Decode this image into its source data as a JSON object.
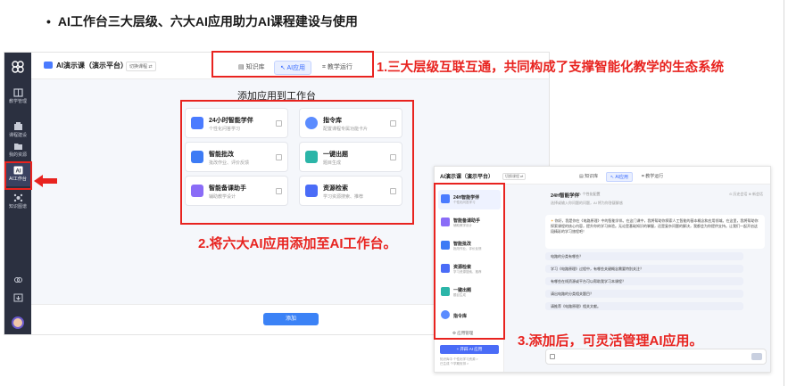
{
  "slide": {
    "bullet": "•",
    "title": "AI工作台三大层级、六大AI应用助力AI课程建设与使用"
  },
  "main_app": {
    "app_name": "AI演示课（演示平台）",
    "switch_course": "切换课程 ⇄",
    "tabs": [
      {
        "label": "知识库",
        "active": false
      },
      {
        "label": "AI应用",
        "active": true
      },
      {
        "label": "教学运行",
        "active": false
      }
    ],
    "sidebar": [
      {
        "label": "教学管理",
        "icon": "book-icon"
      },
      {
        "label": "课程建设",
        "icon": "build-icon"
      },
      {
        "label": "我的资源",
        "icon": "folder-icon"
      },
      {
        "label": "AI工作台",
        "icon": "ai-icon",
        "active": true
      },
      {
        "label": "知识图谱",
        "icon": "graph-icon"
      }
    ],
    "content_title": "添加应用到工作台",
    "apps": [
      {
        "title": "24小时智能学伴",
        "subtitle": "个性化问答学习",
        "color": "#4a7bff"
      },
      {
        "title": "指令库",
        "subtitle": "配置课程专属功能卡片",
        "color": "#5b8cff"
      },
      {
        "title": "智能批改",
        "subtitle": "批改作业、评价反馈",
        "color": "#3d7bf5"
      },
      {
        "title": "一键出题",
        "subtitle": "题目生成",
        "color": "#2bb5a8"
      },
      {
        "title": "智能备课助手",
        "subtitle": "辅助教学设计",
        "color": "#8a6cf7"
      },
      {
        "title": "资源检索",
        "subtitle": "学习资源搜索、推荐",
        "color": "#4a6cf7"
      }
    ],
    "add_button": "添加"
  },
  "annotations": {
    "a1": "1.三大层级互联互通，共同构成了支撑智能化教学的生态系统",
    "a2": "2.将六大AI应用添加至AI工作台。",
    "a3": "3.添加后，可灵活管理AI应用。"
  },
  "second_app": {
    "app_name": "AI演示课（演示平台）",
    "switch_course": "切换课程 ⇄",
    "tabs": [
      "知识库",
      "AI应用",
      "教学运行"
    ],
    "side_items": [
      {
        "title": "24H智能学伴",
        "subtitle": "个性化问答学习",
        "color": "#4a7bff",
        "active": true
      },
      {
        "title": "智能备课助手",
        "subtitle": "辅助教学设计",
        "color": "#8a6cf7"
      },
      {
        "title": "智能批改",
        "subtitle": "批改作业、评价反馈",
        "color": "#3d7bf5"
      },
      {
        "title": "资源检索",
        "subtitle": "学习资源搜索、推荐",
        "color": "#4a6cf7"
      },
      {
        "title": "一键出题",
        "subtitle": "题目生成",
        "color": "#2bb5a8"
      },
      {
        "title": "指令库",
        "subtitle": "",
        "color": "#5b8cff"
      }
    ],
    "manage_label": "⚙ 应用管理",
    "open_button": "+ 开辟 AI 应用",
    "foot1": "知识库中  个性化学习资源 >",
    "foot2": "已生成  个学期安排 >",
    "main_header": "24H智能学伴",
    "main_header_sub": "✎ 个性化配置",
    "main_header_right": "⊙ 历史会话   ⊕ 新会话",
    "main_subtitle": "选择或输入你问题的问题，AI 将为你答疑解惑",
    "welcome": "你好，我是你在《电路原理》中的智能学伴。在这门课中，我将帮助你探索人工智能的基本概念和应用领域。在这里，我将帮助你探索课程的核心内容，提升你的学习体验。无论是基础知识的掌握，还是复杂问题的解决，我都会为你提供支持。让我们一起开启这段精彩的学习旅程吧！",
    "questions": [
      "电路的分类有哪些？",
      "学习《电路原理》过程中，有哪些关键概念需要特别关注？",
      "有哪些在线资源或平台可以帮助我学习本课程？",
      "请出电路的分类相关题目？",
      "请推荐《电路原理》相关文献。"
    ]
  },
  "colors": {
    "accent_red": "#e8231f",
    "primary_blue": "#3b82f6",
    "sidebar_dark": "#2b3040"
  }
}
